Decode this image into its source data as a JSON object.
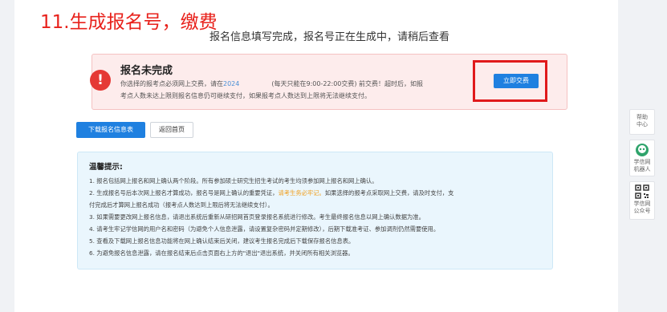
{
  "annotation": {
    "step_title": "11.生成报名号，缴费"
  },
  "status": {
    "title": "报名信息填写完成，报名号正在生成中，请稍后查看"
  },
  "alert": {
    "heading": "报名未完成",
    "line1_a": "你选择的报考点必须网上交费，请在",
    "line1_year": "2024",
    "line1_b": "(每天只能在9:00-22:00交费) 前交费！超时后，如报",
    "line2": "考点人数未达上限则报名信息仍可继续支付，如果报考点人数达到上限将无法继续支付。",
    "pay_button": "立即交费",
    "colors": {
      "background": "#fdecec",
      "icon": "#e53935",
      "button": "#1f80e0",
      "highlight": "#e0191b"
    }
  },
  "actions": {
    "download": "下载报名信息表",
    "home": "返回首页"
  },
  "tips": {
    "heading": "温馨提示:",
    "items": [
      "1. 报名包括网上报名和网上确认两个阶段。所有参加硕士研究生招生考试的考生均须参加网上报名和网上确认。",
      "2. 生成报名号后本次网上报名才算成功，报名号是网上确认的重要凭证，",
      "请考生务必牢记。",
      "如果选择的报考点采取网上交费，请及时支付，支",
      "付完成后才算网上报名成功（报考点人数达到上限后将无法继续支付）。",
      "3. 如果需要更改网上报名信息，请退出系统后重新从研招网首页登录报名系统进行修改。考生最终报名信息以网上确认数据为准。",
      "4. 请考生牢记学信网的用户名和密码（为避免个人信息泄露，请设置复杂密码并定期修改），后期下载准考证、参加调剂仍然需要使用。",
      "5. 查看及下载网上报名信息功能将在网上确认结束后关闭，建议考生报名完成后下载保存报名信息表。",
      "6. 为避免报名信息泄露，请在报名结束后点击页面右上方的\"退出\"退出系统，并关闭所有相关浏览器。"
    ],
    "colors": {
      "background": "#eaf6fd",
      "warning": "#f0a020"
    }
  },
  "sidebar": {
    "help": [
      "帮助",
      "中心"
    ],
    "robot": [
      "学信网",
      "机器人"
    ],
    "wechat": [
      "学信网",
      "公众号"
    ]
  }
}
